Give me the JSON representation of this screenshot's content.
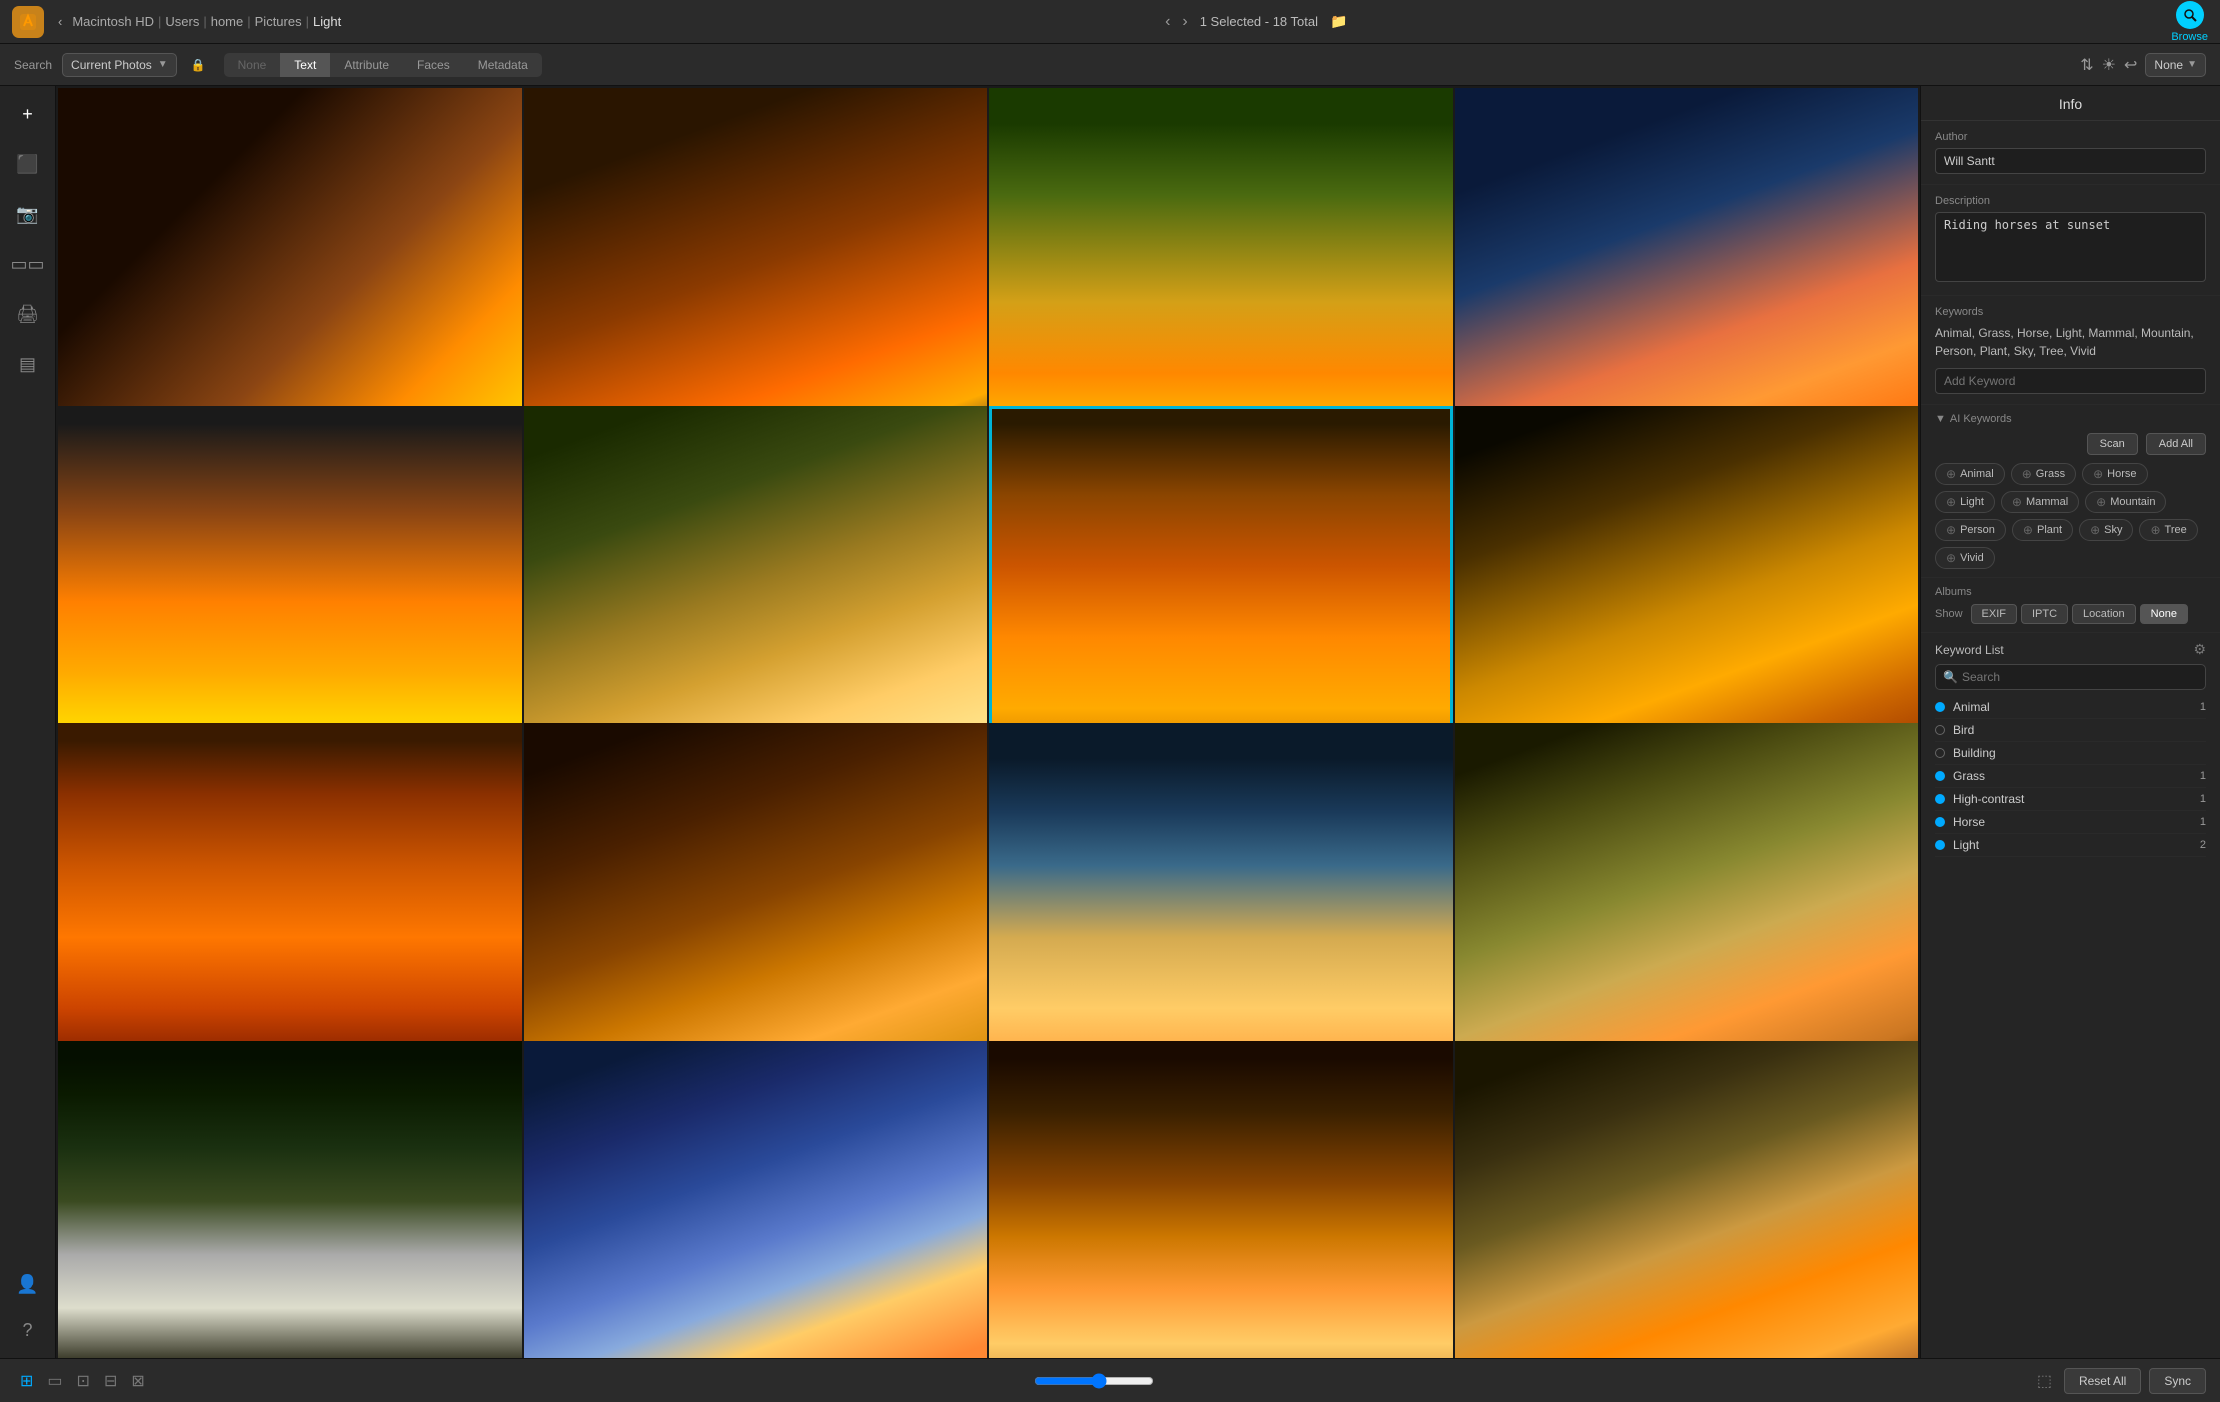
{
  "titlebar": {
    "breadcrumb": [
      "Macintosh HD",
      "Users",
      "home",
      "Pictures",
      "Light"
    ],
    "selection_info": "1 Selected - 18 Total",
    "browse_label": "Browse"
  },
  "toolbar": {
    "search_label": "Search",
    "search_scope": "Current Photos",
    "filter_none": "None",
    "filter_text": "Text",
    "filter_attribute": "Attribute",
    "filter_faces": "Faces",
    "filter_metadata": "Metadata",
    "rating": "None"
  },
  "info_panel": {
    "title": "Info",
    "author_label": "Author",
    "author_value": "Will Santt",
    "description_label": "Description",
    "description_value": "Riding horses at sunset",
    "keywords_label": "Keywords",
    "keywords_value": "Animal, Grass, Horse, Light, Mammal, Mountain, Person, Plant, Sky, Tree, Vivid",
    "add_keyword_placeholder": "Add Keyword",
    "ai_keywords_label": "AI Keywords",
    "scan_btn": "Scan",
    "add_all_btn": "Add All",
    "ai_tags": [
      "Animal",
      "Grass",
      "Horse",
      "Light",
      "Mammal",
      "Mountain",
      "Person",
      "Plant",
      "Sky",
      "Tree",
      "Vivid"
    ],
    "albums_label": "Albums",
    "show_label": "Show",
    "show_options": [
      "EXIF",
      "IPTC",
      "Location",
      "None"
    ]
  },
  "keyword_list": {
    "title": "Keyword List",
    "search_placeholder": "Search",
    "keywords": [
      {
        "name": "Animal",
        "count": 1,
        "filled": true
      },
      {
        "name": "Bird",
        "count": null,
        "filled": false
      },
      {
        "name": "Building",
        "count": null,
        "filled": false
      },
      {
        "name": "Grass",
        "count": 1,
        "filled": true
      },
      {
        "name": "High-contrast",
        "count": 1,
        "filled": true
      },
      {
        "name": "Horse",
        "count": 1,
        "filled": true
      },
      {
        "name": "Light",
        "count": 2,
        "filled": true
      }
    ]
  },
  "bottom_bar": {
    "reset_label": "Reset All",
    "sync_label": "Sync"
  },
  "photos": [
    {
      "id": 1,
      "class": "photo-1",
      "selected": false
    },
    {
      "id": 2,
      "class": "photo-2",
      "selected": false
    },
    {
      "id": 3,
      "class": "photo-3",
      "selected": false
    },
    {
      "id": 4,
      "class": "photo-4",
      "selected": false
    },
    {
      "id": 5,
      "class": "photo-5",
      "selected": false
    },
    {
      "id": 6,
      "class": "photo-6",
      "selected": false
    },
    {
      "id": 7,
      "class": "photo-7",
      "selected": true
    },
    {
      "id": 8,
      "class": "photo-8",
      "selected": false
    },
    {
      "id": 9,
      "class": "photo-9",
      "selected": false
    },
    {
      "id": 10,
      "class": "photo-10",
      "selected": false
    },
    {
      "id": 11,
      "class": "photo-11",
      "selected": false
    },
    {
      "id": 12,
      "class": "photo-12",
      "selected": false
    },
    {
      "id": 13,
      "class": "photo-13",
      "selected": false
    },
    {
      "id": 14,
      "class": "photo-14",
      "selected": false
    },
    {
      "id": 15,
      "class": "photo-15",
      "selected": false
    },
    {
      "id": 16,
      "class": "photo-16",
      "selected": false
    }
  ]
}
